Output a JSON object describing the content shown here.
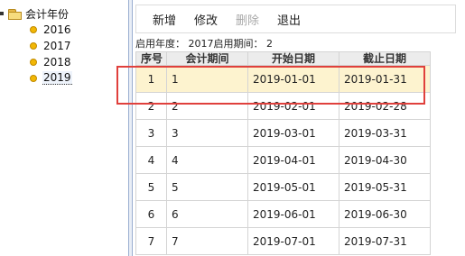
{
  "tree": {
    "root_label": "会计年份",
    "years": [
      "2016",
      "2017",
      "2018",
      "2019"
    ],
    "selected_year": "2019"
  },
  "toolbar": {
    "add": "新增",
    "edit": "修改",
    "delete": "删除",
    "exit": "退出"
  },
  "info": {
    "start_year_label": "启用年度：",
    "start_year": "2017",
    "start_period_label": "启用期间：",
    "start_period": "2"
  },
  "table": {
    "columns": [
      "序号",
      "会计期间",
      "开始日期",
      "截止日期"
    ],
    "rows": [
      [
        "1",
        "1",
        "2019-01-01",
        "2019-01-31"
      ],
      [
        "2",
        "2",
        "2019-02-01",
        "2019-02-28"
      ],
      [
        "3",
        "3",
        "2019-03-01",
        "2019-03-31"
      ],
      [
        "4",
        "4",
        "2019-04-01",
        "2019-04-30"
      ],
      [
        "5",
        "5",
        "2019-05-01",
        "2019-05-31"
      ],
      [
        "6",
        "6",
        "2019-06-01",
        "2019-06-30"
      ],
      [
        "7",
        "7",
        "2019-07-01",
        "2019-07-31"
      ]
    ],
    "selected_row": 0
  },
  "colors": {
    "selected_row_bg": "#fdf3cf",
    "highlight_border": "#e0403c",
    "year_dot": "#f2b705"
  }
}
